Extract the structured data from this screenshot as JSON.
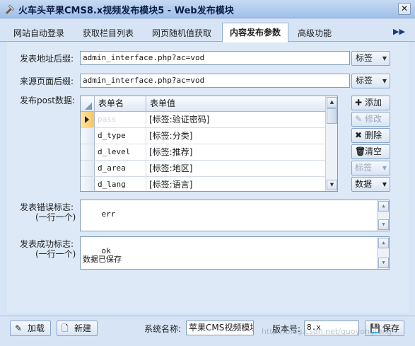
{
  "window": {
    "title": "火车头苹果CMS8.x视频发布模块5 - Web发布模块",
    "close_glyph": "✕"
  },
  "tabs": [
    {
      "label": "网站自动登录"
    },
    {
      "label": "获取栏目列表"
    },
    {
      "label": "网页随机值获取"
    },
    {
      "label": "内容发布参数"
    },
    {
      "label": "高级功能"
    }
  ],
  "tab_next_glyph": "▶▶",
  "form": {
    "post_url_label": "发表地址后缀:",
    "post_url_value": "admin_interface.php?ac=vod",
    "referer_label": "来源页面后缀:",
    "referer_value": "admin_interface.php?ac=vod",
    "tag_dropdown_label": "标签",
    "post_data_label": "发布post数据:",
    "error_label": "发表错误标志:",
    "error_sub": "(一行一个)",
    "error_value": "err",
    "success_label": "发表成功标志:",
    "success_sub": "(一行一个)",
    "success_value": "ok\n数据已保存"
  },
  "grid": {
    "columns": [
      "表单名",
      "表单值"
    ],
    "rows": [
      {
        "name": "pass",
        "value": "[标签:验证密码]"
      },
      {
        "name": "d_type",
        "value": "[标签:分类]"
      },
      {
        "name": "d_level",
        "value": "[标签:推荐]"
      },
      {
        "name": "d_area",
        "value": "[标签:地区]"
      },
      {
        "name": "d_lang",
        "value": "[标签:语言]"
      }
    ]
  },
  "side_buttons": {
    "add": "添加",
    "edit": "修改",
    "delete": "删除",
    "clear": "清空",
    "tag": "标签",
    "data": "数据"
  },
  "bottom": {
    "load": "加载",
    "new": "新建",
    "system_name_label": "系统名称:",
    "system_name_value": "苹果CMS视频模块",
    "version_label": "版本号:",
    "version_value": "8.x",
    "save": "保存",
    "watermark": "http://blog.csdn.net/guoyongfeng"
  },
  "colors": {
    "window_bg": "#d6e4f5",
    "titlebar": "#9fc0ea",
    "current_row_marker": "#f6c55c"
  },
  "icons": [
    "app-icon",
    "close-icon",
    "tab-next-icon",
    "row-pointer-icon",
    "plus-icon",
    "edit-icon",
    "delete-x-icon",
    "trash-icon",
    "load-icon",
    "new-file-icon",
    "save-icon"
  ]
}
